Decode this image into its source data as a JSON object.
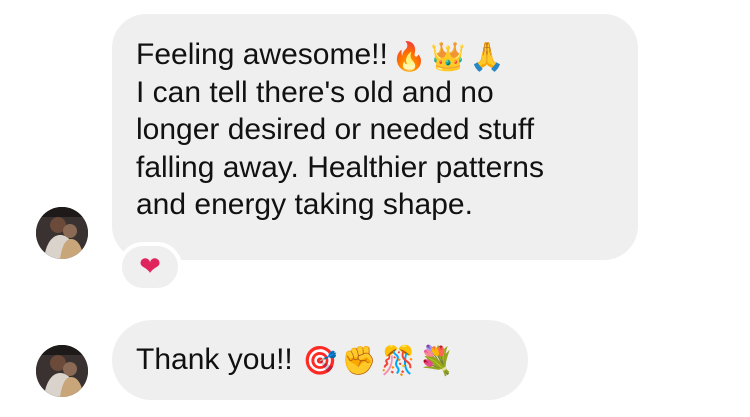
{
  "messages": [
    {
      "lines": [
        "Feeling awesome!!",
        "I can tell there's old and no",
        "longer desired or needed stuff",
        "falling away. Healthier patterns",
        "and energy taking shape."
      ],
      "emojis": [
        "🔥",
        "👑",
        "🙏"
      ],
      "reaction": "❤"
    },
    {
      "text": "Thank you!!",
      "emojis": [
        "🎯",
        "✊",
        "🎊",
        "💐"
      ]
    }
  ],
  "colors": {
    "bubble_bg": "#efefef",
    "text": "#111111",
    "heart": "#e0245e"
  }
}
